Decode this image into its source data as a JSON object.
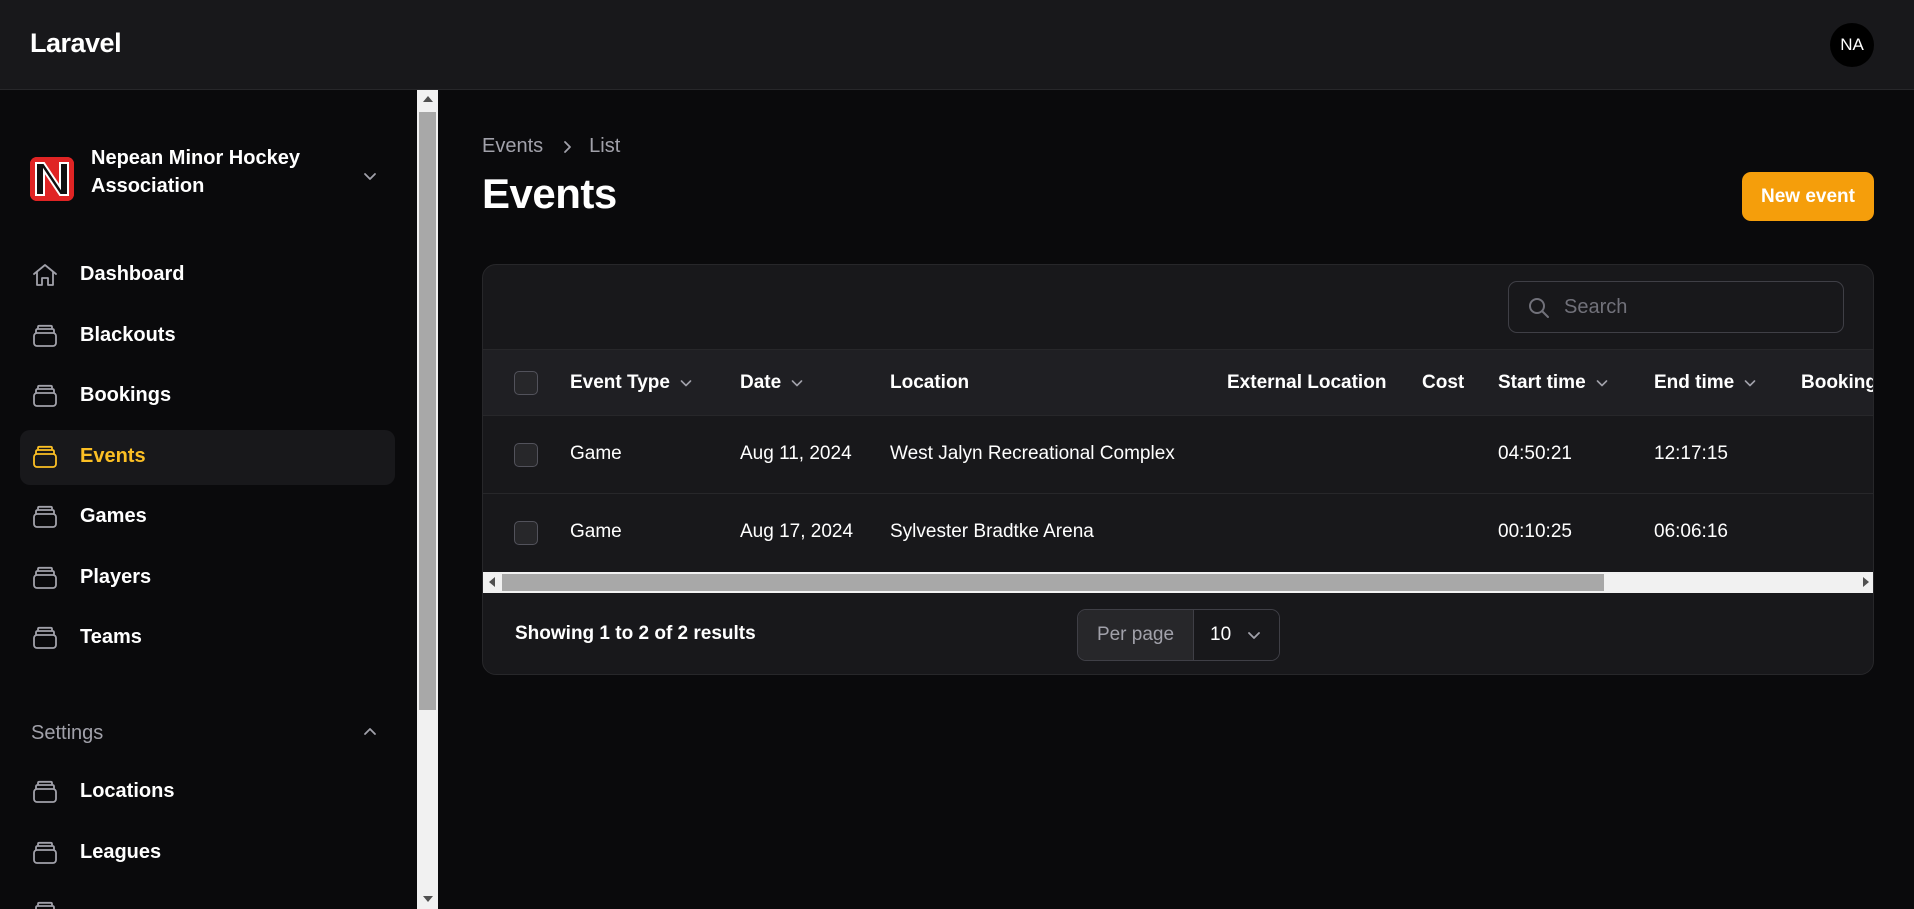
{
  "app": {
    "brand": "Laravel",
    "user_initials": "NA"
  },
  "tenant": {
    "name": "Nepean Minor Hockey Association",
    "logo_color": "#e02424"
  },
  "sidebar": {
    "items": [
      {
        "label": "Dashboard",
        "icon": "home-icon",
        "active": false
      },
      {
        "label": "Blackouts",
        "icon": "stack-icon",
        "active": false
      },
      {
        "label": "Bookings",
        "icon": "stack-icon",
        "active": false
      },
      {
        "label": "Events",
        "icon": "stack-icon",
        "active": true
      },
      {
        "label": "Games",
        "icon": "stack-icon",
        "active": false
      },
      {
        "label": "Players",
        "icon": "stack-icon",
        "active": false
      },
      {
        "label": "Teams",
        "icon": "stack-icon",
        "active": false
      }
    ],
    "settings_group": {
      "label": "Settings",
      "items": [
        {
          "label": "Locations",
          "icon": "stack-icon"
        },
        {
          "label": "Leagues",
          "icon": "stack-icon"
        }
      ]
    }
  },
  "breadcrumb": {
    "items": [
      "Events",
      "List"
    ]
  },
  "page": {
    "title": "Events",
    "new_button": "New event"
  },
  "search": {
    "placeholder": "Search"
  },
  "table": {
    "columns": [
      "Event Type",
      "Date",
      "Location",
      "External Location",
      "Cost",
      "Start time",
      "End time",
      "Booking"
    ],
    "rows": [
      {
        "event_type": "Game",
        "date": "Aug 11, 2024",
        "location": "West Jalyn Recreational Complex",
        "external_location": "",
        "cost": "",
        "start_time": "04:50:21",
        "end_time": "12:17:15"
      },
      {
        "event_type": "Game",
        "date": "Aug 17, 2024",
        "location": "Sylvester Bradtke Arena",
        "external_location": "",
        "cost": "",
        "start_time": "00:10:25",
        "end_time": "06:06:16"
      }
    ]
  },
  "pagination": {
    "summary": "Showing 1 to 2 of 2 results",
    "per_page_label": "Per page",
    "per_page_value": "10"
  },
  "colors": {
    "accent": "#f59e0b",
    "active_text": "#fbbf24",
    "background": "#0a0a0c",
    "surface": "#18181b"
  }
}
